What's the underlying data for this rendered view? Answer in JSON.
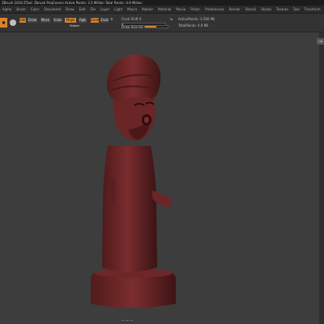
{
  "window": {
    "title": "ZBrush 2018  ZTool: Zbrush ProjCovers  Active Points: 3.5 Million  Total Points: 4.9 Million"
  },
  "menu": {
    "items": [
      "Alpha",
      "Brush",
      "Color",
      "Document",
      "Draw",
      "Edit",
      "File",
      "Layer",
      "Light",
      "Macro",
      "Marker",
      "Material",
      "Movie",
      "Picker",
      "Preferences",
      "Render",
      "Stencil",
      "Stroke",
      "Texture",
      "Tool",
      "Transform",
      "Zplugin",
      "Zscript",
      "Help"
    ]
  },
  "toolbar": {
    "edit_label": "Edit",
    "draw_label": "Draw",
    "move_label": "Move",
    "scale_label": "Scale",
    "rotate_label": "Rotate",
    "mrgb_label": "Mrgb",
    "rgb_label": "Rgb",
    "m_label": "M",
    "zadd_label": "Zadd",
    "zsub_label": "Zsub",
    "focal_label": "Focal Shift 0",
    "draw_size_label": "Draw Size 64",
    "active_points_label": "ActivePoints: 3.566 Mil",
    "total_points_label": "TotalPoints: 4.9 Mil",
    "rgb_intensity": 0.6,
    "z_intensity": 0.5
  },
  "right_panel": {
    "tab_label": "Lig"
  },
  "status": {
    "bottom_label": "— — —"
  },
  "colors": {
    "accent": "#d9832e",
    "model": "#6a2526",
    "background": "#3d3d3d"
  }
}
